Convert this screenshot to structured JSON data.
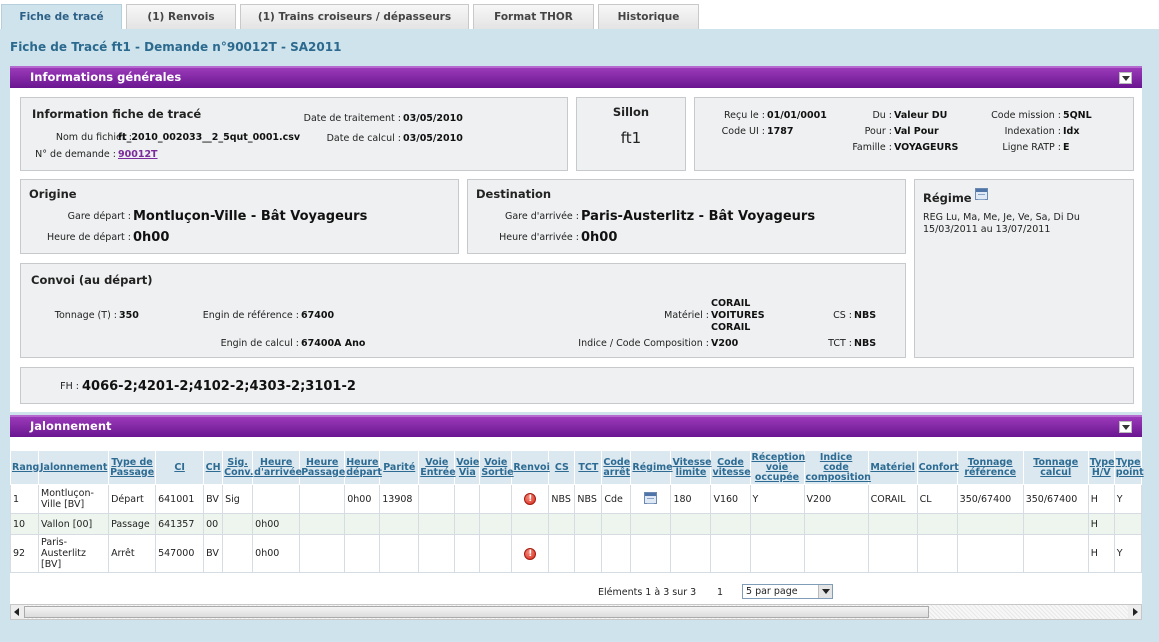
{
  "tabs": [
    {
      "label": "Fiche de tracé",
      "active": true
    },
    {
      "label": "(1) Renvois",
      "active": false
    },
    {
      "label": "(1) Trains croiseurs / dépasseurs",
      "active": false
    },
    {
      "label": "Format THOR",
      "active": false
    },
    {
      "label": "Historique",
      "active": false
    }
  ],
  "page_title": "Fiche de Tracé ft1 - Demande n°90012T - SA2011",
  "general": {
    "header": "Informations générales",
    "info_fiche": {
      "title": "Information fiche de tracé",
      "nom_fichier_label": "Nom du fichier :",
      "nom_fichier": "ft_2010_002033__2_5qut_0001.csv",
      "num_demande_label": "N° de demande :",
      "num_demande": "90012T",
      "date_traitement_label": "Date de traitement :",
      "date_traitement": "03/05/2010",
      "date_calcul_label": "Date de calcul :",
      "date_calcul": "03/05/2010"
    },
    "sillon": {
      "title": "Sillon",
      "value": "ft1"
    },
    "misc": {
      "recu_le_label": "Reçu le :",
      "recu_le": "01/01/0001",
      "code_ui_label": "Code UI :",
      "code_ui": "1787",
      "du_label": "Du :",
      "du": "Valeur DU",
      "pour_label": "Pour :",
      "pour": "Val Pour",
      "famille_label": "Famille :",
      "famille": "VOYAGEURS",
      "code_mission_label": "Code mission :",
      "code_mission": "5QNL",
      "indexation_label": "Indexation :",
      "indexation": "Idx",
      "ligne_ratp_label": "Ligne RATP :",
      "ligne_ratp": "E"
    },
    "origine": {
      "title": "Origine",
      "gare_label": "Gare départ :",
      "gare": "Montluçon-Ville - Bât Voyageurs",
      "heure_label": "Heure de départ :",
      "heure": "0h00"
    },
    "destination": {
      "title": "Destination",
      "gare_label": "Gare d'arrivée :",
      "gare": "Paris-Austerlitz - Bât Voyageurs",
      "heure_label": "Heure d'arrivée :",
      "heure": "0h00"
    },
    "regime": {
      "title": "Régime",
      "line1": "REG Lu, Ma, Me, Je, Ve, Sa, Di Du",
      "line2": "15/03/2011 au 13/07/2011"
    },
    "convoi": {
      "title": "Convoi (au départ)",
      "tonnage_label": "Tonnage (T) :",
      "tonnage": "350",
      "engin_ref_label": "Engin de référence :",
      "engin_ref": "67400",
      "engin_calc_label": "Engin de calcul :",
      "engin_calc": "67400A Ano",
      "materiel_label": "Matériel :",
      "materiel_lines": [
        "CORAIL",
        "VOITURES",
        "CORAIL"
      ],
      "indice_label": "Indice / Code Composition :",
      "indice": "V200",
      "cs_label": "CS :",
      "cs": "NBS",
      "tct_label": "TCT :",
      "tct": "NBS"
    },
    "fh": {
      "label": "FH :",
      "value": "4066-2;4201-2;4102-2;4303-2;3101-2"
    }
  },
  "jalonnement": {
    "header": "Jalonnement",
    "columns": [
      "Rang",
      "Jalonnement",
      "Type de Passage",
      "CI",
      "CH",
      "Sig. Conv.",
      "Heure d'arrivée",
      "Heure Passage",
      "Heure départ",
      "Parité",
      "Voie Entrée",
      "Voie Via",
      "Voie Sortie",
      "Renvoi",
      "CS",
      "TCT",
      "Code arrêt",
      "Régime",
      "Vitesse limite",
      "Code vitesse",
      "Réception voie occupée",
      "Indice code composition",
      "Matériel",
      "Confort",
      "Tonnage référence",
      "Tonnage calcul",
      "Type H/V",
      "Type point"
    ],
    "rows": [
      [
        "1",
        "Montluçon-Ville [BV]",
        "Départ",
        "641001",
        "BV",
        "Sig",
        "",
        "",
        "0h00",
        "13908",
        "",
        "",
        "",
        "!",
        "NBS",
        "NBS",
        "Cde",
        "cal",
        "180",
        "V160",
        "Y",
        "V200",
        "CORAIL",
        "CL",
        "350/67400",
        "350/67400",
        "H",
        "Y"
      ],
      [
        "10",
        "Vallon [00]",
        "Passage",
        "641357",
        "00",
        "",
        "0h00",
        "",
        "",
        "",
        "",
        "",
        "",
        "",
        "",
        "",
        "",
        "",
        "",
        "",
        "",
        "",
        "",
        "",
        "",
        "",
        "H",
        ""
      ],
      [
        "92",
        "Paris-Austerlitz [BV]",
        "Arrêt",
        "547000",
        "BV",
        "",
        "0h00",
        "",
        "",
        "",
        "",
        "",
        "",
        "!",
        "",
        "",
        "",
        "",
        "",
        "",
        "",
        "",
        "",
        "",
        "",
        "",
        "H",
        "Y"
      ]
    ],
    "pager": {
      "summary": "Eléments 1 à 3 sur 3",
      "page": "1",
      "per_page": "5 par page"
    }
  }
}
